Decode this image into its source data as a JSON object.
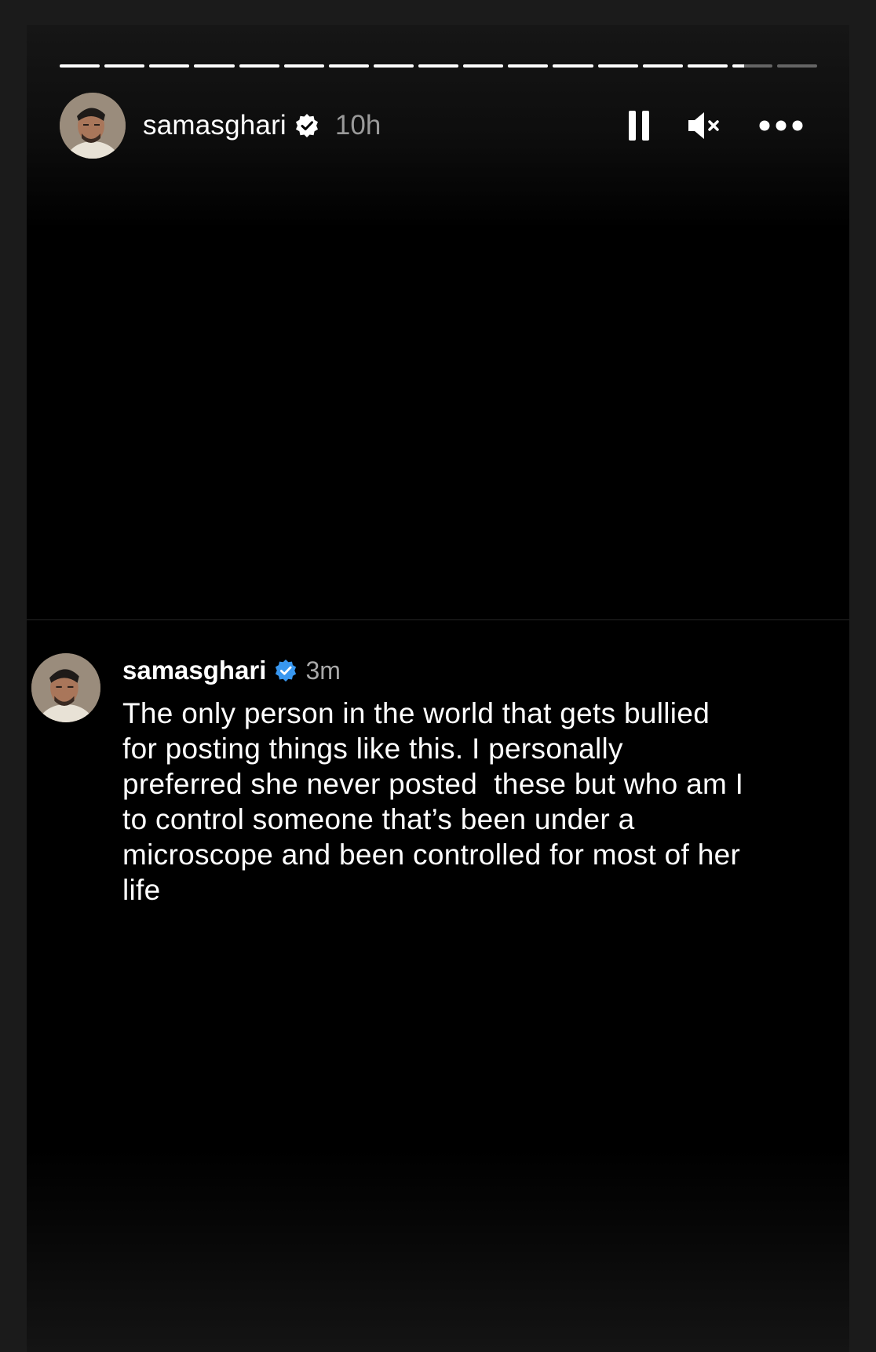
{
  "progress": {
    "segments_total": 17,
    "segments_completed": 15,
    "current_segment_fraction": 0.3
  },
  "header": {
    "username": "samasghari",
    "verified_icon": "verified-badge-icon",
    "time": "10h",
    "pause_icon": "pause-icon",
    "mute_icon": "muted-speaker-icon",
    "more_icon": "more-dots-icon"
  },
  "comment": {
    "username": "samasghari",
    "verified_icon": "verified-badge-icon",
    "verified_color": "#3897f0",
    "time": "3m",
    "text": "The only person in the world that gets bullied\nfor posting things like this. I personally\npreferred she never posted  these but who am I\nto control someone that’s been under a\nmicroscope and been controlled for most of her\nlife"
  }
}
